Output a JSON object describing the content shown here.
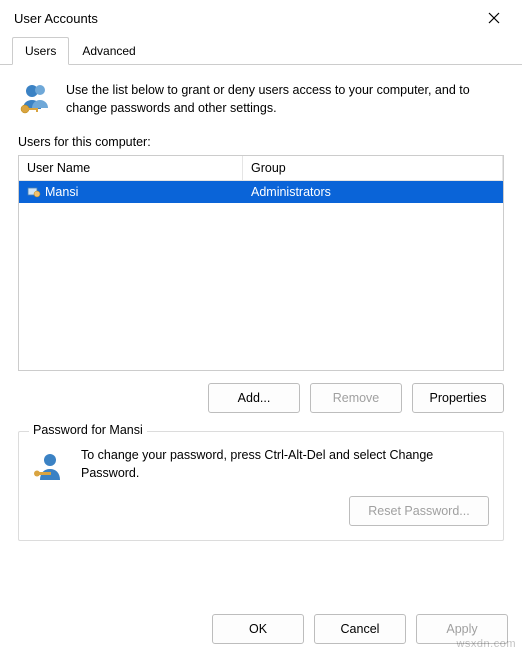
{
  "window": {
    "title": "User Accounts"
  },
  "tabs": [
    {
      "label": "Users",
      "active": true
    },
    {
      "label": "Advanced",
      "active": false
    }
  ],
  "intro": {
    "text": "Use the list below to grant or deny users access to your computer, and to change passwords and other settings."
  },
  "users_section": {
    "label": "Users for this computer:",
    "columns": {
      "name": "User Name",
      "group": "Group"
    },
    "rows": [
      {
        "name": "Mansi",
        "group": "Administrators",
        "selected": true
      }
    ]
  },
  "buttons": {
    "add": "Add...",
    "remove": "Remove",
    "properties": "Properties"
  },
  "password_box": {
    "title": "Password for Mansi",
    "text": "To change your password, press Ctrl-Alt-Del and select Change Password.",
    "reset": "Reset Password..."
  },
  "dialog": {
    "ok": "OK",
    "cancel": "Cancel",
    "apply": "Apply"
  },
  "watermark": "wsxdn.com"
}
